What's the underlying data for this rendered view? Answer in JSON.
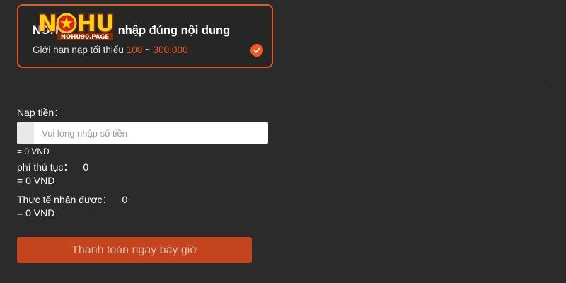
{
  "option_card": {
    "title_prefix": "NOH",
    "title_suffix": "nhập đúng nội dung",
    "limit_label": "Giới hạn nạp tối thiểu",
    "limit_min": "100",
    "limit_sep": "~",
    "limit_max": "300,000",
    "logo_text": "NOHU",
    "logo_subtext": "NOHU90.PAGE",
    "check_icon": "check-circle-icon"
  },
  "form": {
    "deposit_label": "Nạp tiền：",
    "amount_placeholder": "Vui lòng nhập số tiền",
    "amount_converted": "= 0 VND",
    "fee_label": "phí thủ tục：",
    "fee_value": "0",
    "fee_converted": "= 0 VND",
    "receive_label": "Thực tế nhận được：",
    "receive_value": "0",
    "receive_converted": "= 0 VND"
  },
  "actions": {
    "pay_label": "Thanh toán ngay bây giờ"
  },
  "colors": {
    "accent": "#f05a22",
    "background": "#2b2b2b",
    "button": "#c4451d"
  }
}
